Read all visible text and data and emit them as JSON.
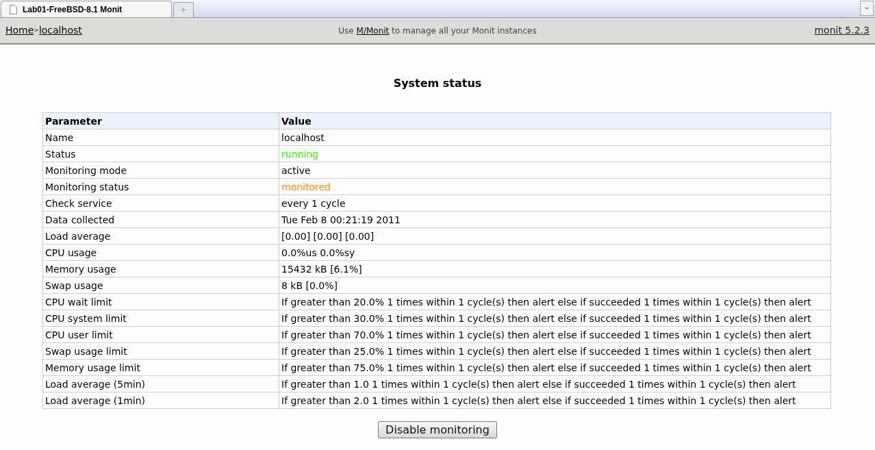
{
  "browser": {
    "tab_title": "Lab01-FreeBSD-8.1 Monit",
    "new_tab": "+"
  },
  "header": {
    "breadcrumb": [
      {
        "label": "Home"
      },
      {
        "label": "localhost"
      }
    ],
    "separator": ">",
    "notice": {
      "before": "Use ",
      "link": "M/Monit",
      "after": " to manage all your Monit instances"
    },
    "version": "monit 5.2.3"
  },
  "title": "System status",
  "table": {
    "columns": [
      "Parameter",
      "Value"
    ],
    "rows": [
      {
        "parameter": "Name",
        "value": "localhost"
      },
      {
        "parameter": "Status",
        "value": "running",
        "color": "#33ff00"
      },
      {
        "parameter": "Monitoring mode",
        "value": "active"
      },
      {
        "parameter": "Monitoring status",
        "value": "monitored",
        "color": "#ff8c00"
      },
      {
        "parameter": "Check service",
        "value": "every 1 cycle"
      },
      {
        "parameter": "Data collected",
        "value": "Tue Feb 8 00:21:19 2011"
      },
      {
        "parameter": "Load average",
        "value": "[0.00] [0.00] [0.00]"
      },
      {
        "parameter": "CPU usage",
        "value": "0.0%us 0.0%sy"
      },
      {
        "parameter": "Memory usage",
        "value": "15432 kB [6.1%]"
      },
      {
        "parameter": "Swap usage",
        "value": "8 kB [0.0%]"
      },
      {
        "parameter": "CPU wait limit",
        "value": "If greater than 20.0% 1 times within 1 cycle(s) then alert else if succeeded 1 times within 1 cycle(s) then alert"
      },
      {
        "parameter": "CPU system limit",
        "value": "If greater than 30.0% 1 times within 1 cycle(s) then alert else if succeeded 1 times within 1 cycle(s) then alert"
      },
      {
        "parameter": "CPU user limit",
        "value": "If greater than 70.0% 1 times within 1 cycle(s) then alert else if succeeded 1 times within 1 cycle(s) then alert"
      },
      {
        "parameter": "Swap usage limit",
        "value": "If greater than 25.0% 1 times within 1 cycle(s) then alert else if succeeded 1 times within 1 cycle(s) then alert"
      },
      {
        "parameter": "Memory usage limit",
        "value": "If greater than 75.0% 1 times within 1 cycle(s) then alert else if succeeded 1 times within 1 cycle(s) then alert"
      },
      {
        "parameter": "Load average (5min)",
        "value": "If greater than 1.0 1 times within 1 cycle(s) then alert else if succeeded 1 times within 1 cycle(s) then alert"
      },
      {
        "parameter": "Load average (1min)",
        "value": "If greater than 2.0 1 times within 1 cycle(s) then alert else if succeeded 1 times within 1 cycle(s) then alert"
      }
    ]
  },
  "button": "Disable monitoring"
}
